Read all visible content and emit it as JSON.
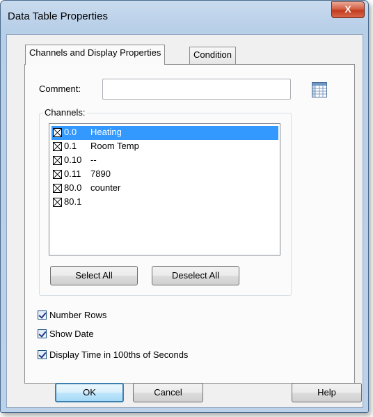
{
  "window": {
    "title": "Data Table Properties",
    "close_glyph": "X"
  },
  "tabs": [
    {
      "label": "Channels and Display Properties",
      "active": true
    },
    {
      "label": "Condition",
      "active": false
    }
  ],
  "comment": {
    "label": "Comment:",
    "value": ""
  },
  "table_icon": "table-grid-icon",
  "channels": {
    "label": "Channels:",
    "items": [
      {
        "channel": "0.0",
        "name": "Heating",
        "checked": true,
        "selected": true
      },
      {
        "channel": "0.1",
        "name": "Room Temp",
        "checked": true,
        "selected": false
      },
      {
        "channel": "0.10",
        "name": "--",
        "checked": true,
        "selected": false
      },
      {
        "channel": "0.11",
        "name": "7890",
        "checked": true,
        "selected": false
      },
      {
        "channel": "80.0",
        "name": "counter",
        "checked": true,
        "selected": false
      },
      {
        "channel": "80.1",
        "name": "",
        "checked": true,
        "selected": false
      }
    ],
    "select_all": "Select All",
    "deselect_all": "Deselect All"
  },
  "options": [
    {
      "label": "Number Rows",
      "checked": true
    },
    {
      "label": "Show Date",
      "checked": true
    },
    {
      "label": "Display Time in 100ths of Seconds",
      "checked": true
    }
  ],
  "buttons": {
    "ok": "OK",
    "cancel": "Cancel",
    "help": "Help"
  },
  "colors": {
    "selection": "#3399ff",
    "frame": "#b8cfe8",
    "close": "#c2391b"
  }
}
